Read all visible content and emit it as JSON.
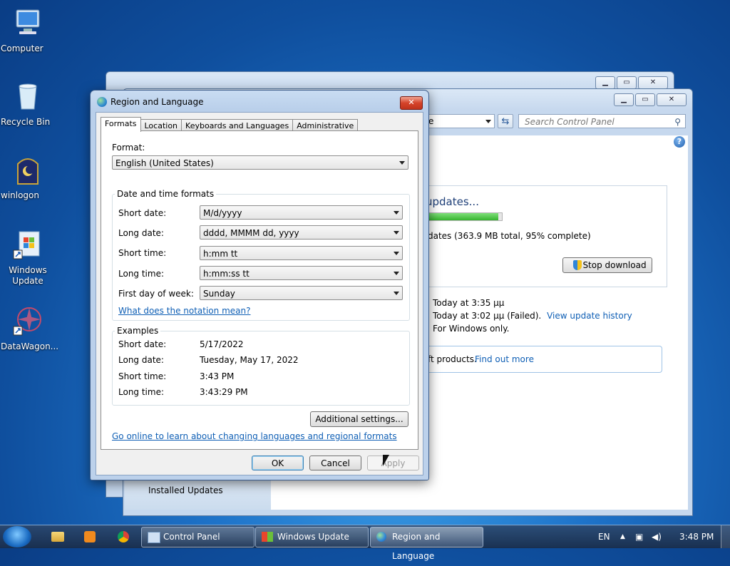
{
  "desktop": {
    "icons": [
      {
        "label": "Computer"
      },
      {
        "label": "Recycle Bin"
      },
      {
        "label": "winlogon"
      },
      {
        "label": "Windows Update"
      },
      {
        "label": "DataWagon..."
      }
    ]
  },
  "control_panel": {
    "search_placeholder": "Search Control Panel",
    "address_partial": "e",
    "status_title": "updates...",
    "status_detail": "dates (363.9 MB total, 95% complete)",
    "progress_fraction": 0.95,
    "stop_button": "Stop download",
    "recent_check": "Today at 3:35 μμ",
    "installed_line": "Today at 3:02 μμ (Failed).",
    "view_history_link": "View update history",
    "receive_line": "For Windows only.",
    "products_text": "ft products.",
    "find_out_link": "Find out more",
    "installed_updates": "Installed Updates"
  },
  "dialog": {
    "title": "Region and Language",
    "tabs": [
      "Formats",
      "Location",
      "Keyboards and Languages",
      "Administrative"
    ],
    "format_label": "Format:",
    "format_value": "English (United States)",
    "dt_group_title": "Date and time formats",
    "short_date_label": "Short date:",
    "short_date_value": "M/d/yyyy",
    "long_date_label": "Long date:",
    "long_date_value": "dddd, MMMM dd, yyyy",
    "short_time_label": "Short time:",
    "short_time_value": "h:mm tt",
    "long_time_label": "Long time:",
    "long_time_value": "h:mm:ss tt",
    "first_day_label": "First day of week:",
    "first_day_value": "Sunday",
    "notation_link": "What does the notation mean?",
    "examples_title": "Examples",
    "ex_short_date_label": "Short date:",
    "ex_short_date_value": "5/17/2022",
    "ex_long_date_label": "Long date:",
    "ex_long_date_value": "Tuesday, May 17, 2022",
    "ex_short_time_label": "Short time:",
    "ex_short_time_value": "3:43 PM",
    "ex_long_time_label": "Long time:",
    "ex_long_time_value": "3:43:29 PM",
    "additional_button": "Additional settings...",
    "online_link": "Go online to learn about changing languages and regional formats",
    "ok": "OK",
    "cancel": "Cancel",
    "apply": "Apply"
  },
  "taskbar": {
    "items": [
      "Control Panel",
      "Windows Update",
      "Region and Language"
    ],
    "lang": "EN",
    "clock": "3:48 PM"
  }
}
